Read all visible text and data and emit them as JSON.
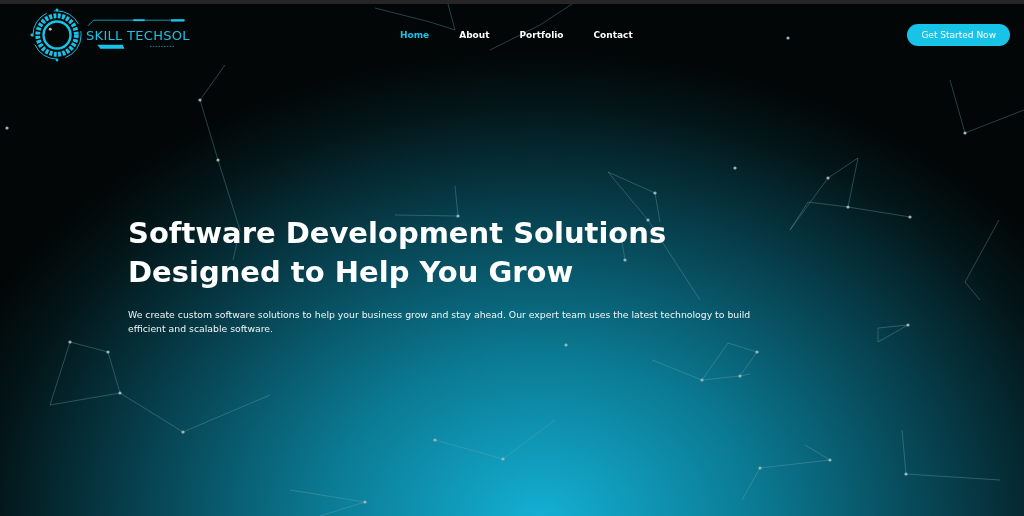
{
  "logo": {
    "text": "SKILL TECHSOL"
  },
  "nav": [
    {
      "label": "Home",
      "selected": true
    },
    {
      "label": "About",
      "selected": false
    },
    {
      "label": "Portfolio",
      "selected": false
    },
    {
      "label": "Contact",
      "selected": false
    }
  ],
  "cta": {
    "label": "Get Started Now"
  },
  "hero": {
    "title_lines": [
      "Software Development Solutions",
      "Designed to Help You Grow"
    ],
    "description": "We create custom software solutions to help your business grow and stay ahead. Our expert team uses the latest technology to build efficient and scalable software."
  }
}
